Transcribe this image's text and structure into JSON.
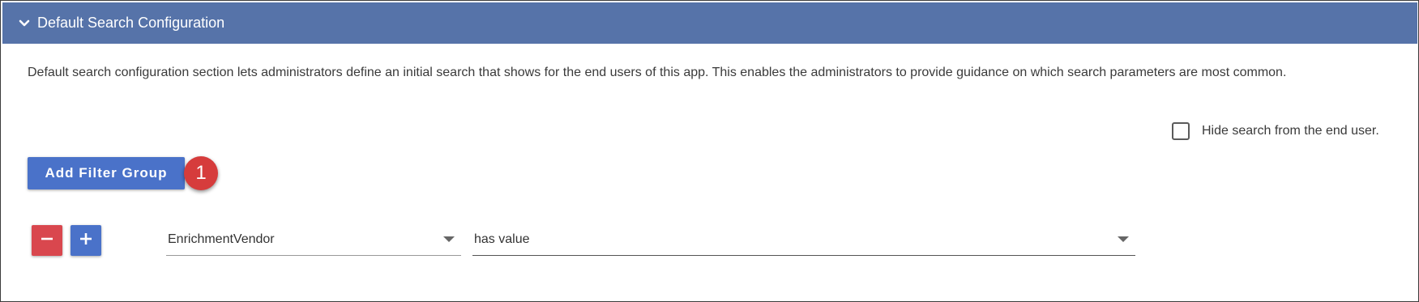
{
  "section": {
    "title": "Default Search Configuration",
    "description": "Default search configuration section lets administrators define an initial search that shows for the end users of this app. This enables the administrators to provide guidance on which search parameters are most common."
  },
  "options": {
    "hide_search_label": "Hide search from the end user.",
    "hide_search_checked": false
  },
  "actions": {
    "add_filter_group_label": "Add Filter Group",
    "callout_number": "1"
  },
  "filter_row": {
    "field_value": "EnrichmentVendor",
    "operator_value": "has value",
    "remove_icon": "minus-icon",
    "add_icon": "plus-icon"
  },
  "colors": {
    "header": "#5673a9",
    "primary_button": "#4a72c9",
    "danger_button": "#d9474e",
    "callout": "#d63c3c"
  }
}
